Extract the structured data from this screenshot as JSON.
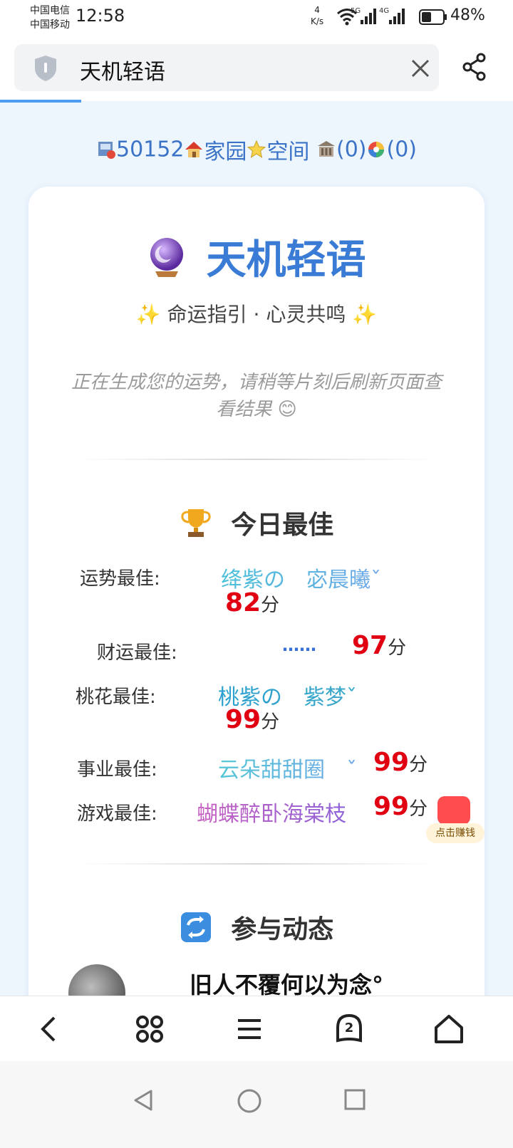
{
  "status": {
    "carrier1": "中国电信",
    "carrier2": "中国移动",
    "time": "12:58",
    "speed_value": "4",
    "speed_unit": "K/s",
    "net1": "5G",
    "net2": "4G",
    "battery": "48%",
    "battery_level": 0.48
  },
  "browser": {
    "page_title": "天机轻语",
    "close_icon": "close-icon",
    "share_icon": "share-icon",
    "tab_count": "2"
  },
  "links": {
    "id": "50152",
    "home": "家园",
    "space": "空间",
    "count1": "(0)",
    "count2": "(0)"
  },
  "app": {
    "title": "天机轻语",
    "subtitle": "✨ 命运指引 · 心灵共鸣 ✨",
    "notice": "正在生成您的运势，请稍等片刻后刷新页面查看结果 😊"
  },
  "best": {
    "title": "今日最佳",
    "unit": "分",
    "rows": [
      {
        "label": "运势最佳:",
        "name": "绛紫の　宓晨曦ˇ",
        "score": "82"
      },
      {
        "label": "财运最佳:",
        "name": "……",
        "score": "97"
      },
      {
        "label": "桃花最佳:",
        "name": "桃紫の　紫梦ˇ",
        "score": "99"
      },
      {
        "label": "事业最佳:",
        "name": "云朵甜甜圈　ˇ",
        "score": "99"
      },
      {
        "label": "游戏最佳:",
        "name": "蝴蝶醉卧海棠枝",
        "score": "99"
      }
    ]
  },
  "dynamics": {
    "title": "参与动态",
    "first_user": "旧人不覆何以为念°"
  },
  "earn_label": "点击赚钱",
  "colors": {
    "accent": "#3a7bd5",
    "score_red": "#e00012",
    "link_blue": "#3b73c7"
  }
}
